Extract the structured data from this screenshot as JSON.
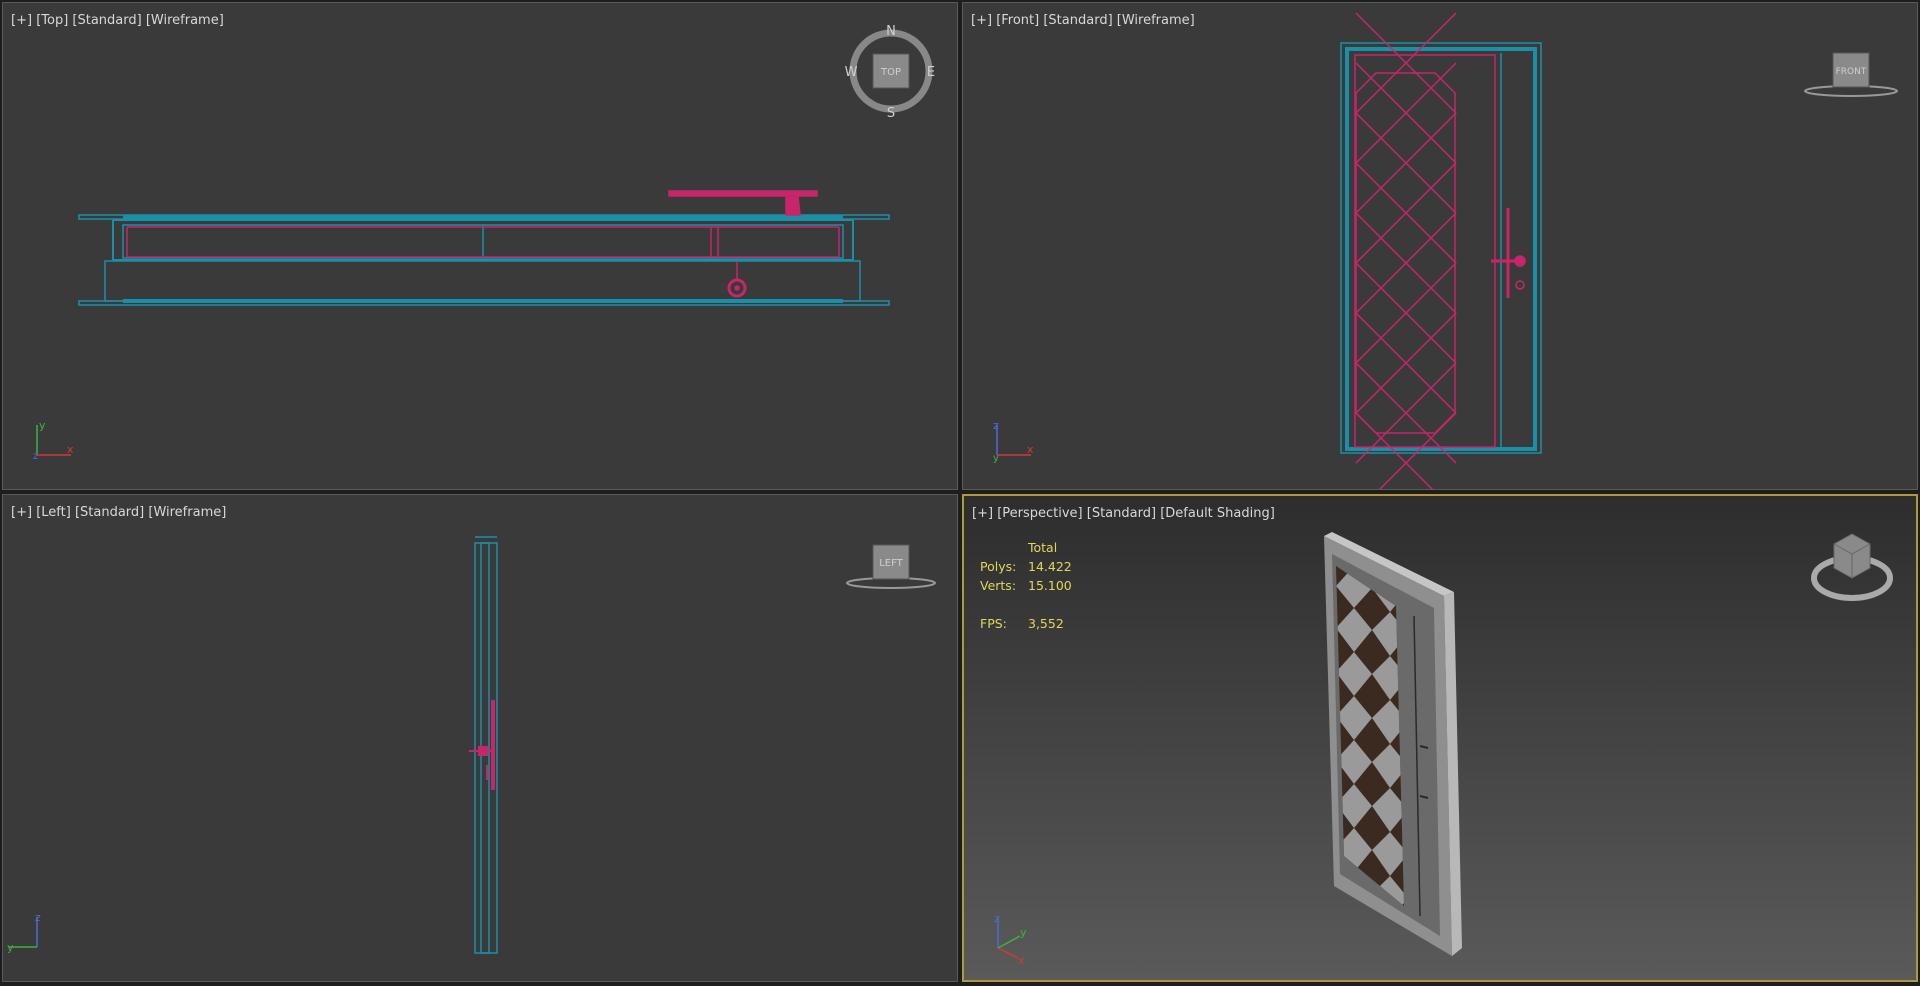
{
  "viewports": {
    "top": {
      "label": [
        "[+]",
        "[Top]",
        "[Standard]",
        "[Wireframe]"
      ],
      "cube": "TOP",
      "compass": {
        "n": "N",
        "s": "S",
        "e": "E",
        "w": "W"
      }
    },
    "front": {
      "label": [
        "[+]",
        "[Front]",
        "[Standard]",
        "[Wireframe]"
      ],
      "cube": "FRONT"
    },
    "left": {
      "label": [
        "[+]",
        "[Left]",
        "[Standard]",
        "[Wireframe]"
      ],
      "cube": "LEFT"
    },
    "perspective": {
      "label": [
        "[+]",
        "[Perspective]",
        "[Standard]",
        "[Default Shading]"
      ],
      "stats": {
        "header": "Total",
        "polys_label": "Polys:",
        "polys": "14.422",
        "verts_label": "Verts:",
        "verts": "15.100",
        "fps_label": "FPS:",
        "fps": "3,552"
      }
    }
  },
  "axes": {
    "x": "x",
    "y": "y",
    "z": "z"
  },
  "colors": {
    "wire_frame": "#1a8fa8",
    "wire_door": "#c8256a",
    "active_border": "#b0983c",
    "stats_text": "#e2d65c"
  }
}
